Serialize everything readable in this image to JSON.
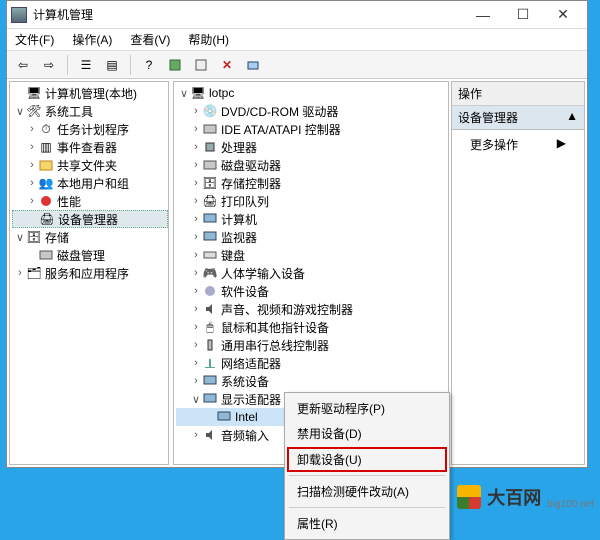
{
  "window": {
    "title": "计算机管理"
  },
  "menubar": {
    "file": "文件(F)",
    "action": "操作(A)",
    "view": "查看(V)",
    "help": "帮助(H)"
  },
  "left_tree": {
    "root": "计算机管理(本地)",
    "system_tools": "系统工具",
    "task_scheduler": "任务计划程序",
    "event_viewer": "事件查看器",
    "shared_folders": "共享文件夹",
    "local_users": "本地用户和组",
    "performance": "性能",
    "device_manager": "设备管理器",
    "storage": "存储",
    "disk_mgmt": "磁盘管理",
    "services_apps": "服务和应用程序"
  },
  "mid_tree": {
    "root": "lotpc",
    "dvd": "DVD/CD-ROM 驱动器",
    "ide": "IDE ATA/ATAPI 控制器",
    "cpu": "处理器",
    "disk_drives": "磁盘驱动器",
    "storage_ctrl": "存储控制器",
    "print_q": "打印队列",
    "computer": "计算机",
    "monitor": "监视器",
    "keyboard": "键盘",
    "hid": "人体学输入设备",
    "software": "软件设备",
    "sound": "声音、视频和游戏控制器",
    "mouse": "鼠标和其他指针设备",
    "usb": "通用串行总线控制器",
    "net": "网络适配器",
    "sys_dev": "系统设备",
    "display": "显示适配器",
    "display_child": "Intel",
    "audio_in": "音频输入"
  },
  "actions": {
    "header": "操作",
    "sub": "设备管理器",
    "arrow": "▲",
    "more": "更多操作",
    "more_arrow": "▶"
  },
  "ctx": {
    "update": "更新驱动程序(P)",
    "disable": "禁用设备(D)",
    "uninstall": "卸载设备(U)",
    "scan": "扫描检测硬件改动(A)",
    "props": "属性(R)"
  },
  "watermark": {
    "name": "大百网",
    "url": "big100.net"
  }
}
